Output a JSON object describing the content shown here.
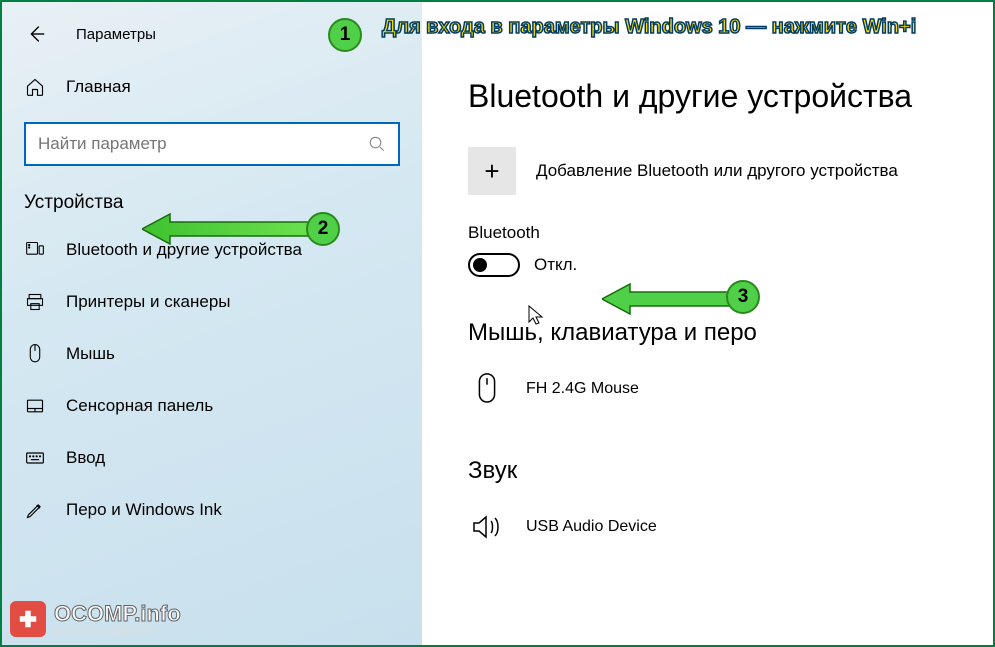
{
  "header": {
    "app_title": "Параметры"
  },
  "sidebar": {
    "home_label": "Главная",
    "search_placeholder": "Найти параметр",
    "category_label": "Устройства",
    "items": [
      {
        "label": "Bluetooth и другие устройства"
      },
      {
        "label": "Принтеры и сканеры"
      },
      {
        "label": "Мышь"
      },
      {
        "label": "Сенсорная панель"
      },
      {
        "label": "Ввод"
      },
      {
        "label": "Перо и Windows Ink"
      }
    ]
  },
  "content": {
    "page_title": "Bluetooth и другие устройства",
    "add_device_label": "Добавление Bluetooth или другого устройства",
    "bt_label": "Bluetooth",
    "bt_state": "Откл.",
    "section_mouse": "Мышь, клавиатура и перо",
    "device_mouse": "FH 2.4G Mouse",
    "section_audio": "Звук",
    "device_audio": "USB Audio Device"
  },
  "annotations": {
    "hint1": "Для входа в параметры Windows 10 — нажмите Win+i",
    "badge1": "1",
    "badge2": "2",
    "badge3": "3"
  },
  "watermark": {
    "main": "OCOMP.info",
    "sub": "ВОПРОСЫ АДМИНУ"
  }
}
